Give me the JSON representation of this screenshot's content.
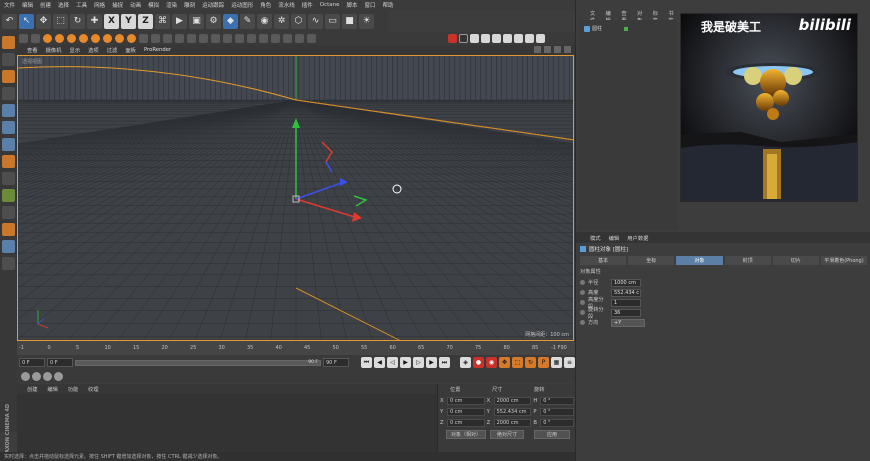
{
  "menu": [
    "文件",
    "编辑",
    "创建",
    "选择",
    "工具",
    "网格",
    "捕捉",
    "动画",
    "模拟",
    "渲染",
    "雕刻",
    "运动跟踪",
    "运动图形",
    "角色",
    "流水线",
    "插件",
    "Octane",
    "脚本",
    "窗口",
    "帮助"
  ],
  "toolbar": {
    "axis_x": "X",
    "axis_y": "Y",
    "axis_z": "Z"
  },
  "viewport_menu": [
    "查看",
    "摄像机",
    "显示",
    "选项",
    "过滤",
    "面板",
    "ProRender"
  ],
  "viewport": {
    "label": "透视视图",
    "grid_spacing": "网格间距：100 cm",
    "colors": {
      "border": "#e39a2d",
      "x_axis": "#e0392d",
      "y_axis": "#2fc13c",
      "z_axis": "#3a50e8"
    }
  },
  "timeline": {
    "ticks": [
      "-1",
      "0",
      "5",
      "10",
      "15",
      "20",
      "25",
      "30",
      "35",
      "40",
      "45",
      "50",
      "55",
      "60",
      "65",
      "70",
      "75",
      "80",
      "85",
      "90"
    ],
    "end_frame": "-1 F"
  },
  "playback": {
    "start": "0 F",
    "current": "0 F",
    "range_end": "90 F",
    "end": "90 F"
  },
  "material_tabs": [
    "创建",
    "编辑",
    "功能",
    "纹理"
  ],
  "coordinates": {
    "headers": [
      "位置",
      "尺寸",
      "旋转"
    ],
    "rows": [
      {
        "axis": "X",
        "pos": "0 cm",
        "size_axis": "X",
        "size": "2000 cm",
        "rot_axis": "H",
        "rot": "0 °"
      },
      {
        "axis": "Y",
        "pos": "0 cm",
        "size_axis": "Y",
        "size": "552.434 cm",
        "rot_axis": "P",
        "rot": "0 °"
      },
      {
        "axis": "Z",
        "pos": "0 cm",
        "size_axis": "Z",
        "size": "2000 cm",
        "rot_axis": "B",
        "rot": "0 °"
      }
    ],
    "mode_select": "对象（相对）",
    "size_select": "绝对尺寸",
    "apply_button": "应用"
  },
  "status_text": "实时选择：点击并拖动鼠标选择元素。按住 SHIFT 键增加选择对象，按住 CTRL 键减少选择对象。",
  "brand": "MAXON CINEMA 4D",
  "object_manager": {
    "menu": [
      "文件",
      "编辑",
      "查看",
      "对象",
      "标签",
      "书签"
    ],
    "object_name": "圆柱"
  },
  "watermark": {
    "text": "我是破美工",
    "logo": "bilibili"
  },
  "attributes": {
    "menu": [
      "模式",
      "编辑",
      "用户数据"
    ],
    "title": "圆柱对象 [圆柱]",
    "tabs": [
      "基本",
      "坐标",
      "对象",
      "封顶",
      "切片",
      "平滑着色(Phong)"
    ],
    "active_tab": 2,
    "section": "对象属性",
    "fields": [
      {
        "label": "半径",
        "value": "1000 cm"
      },
      {
        "label": "高度",
        "value": "552.434 c"
      },
      {
        "label": "高度分段",
        "value": "1"
      },
      {
        "label": "旋转分段",
        "value": "36"
      },
      {
        "label": "方向",
        "value": "+Y"
      }
    ]
  }
}
